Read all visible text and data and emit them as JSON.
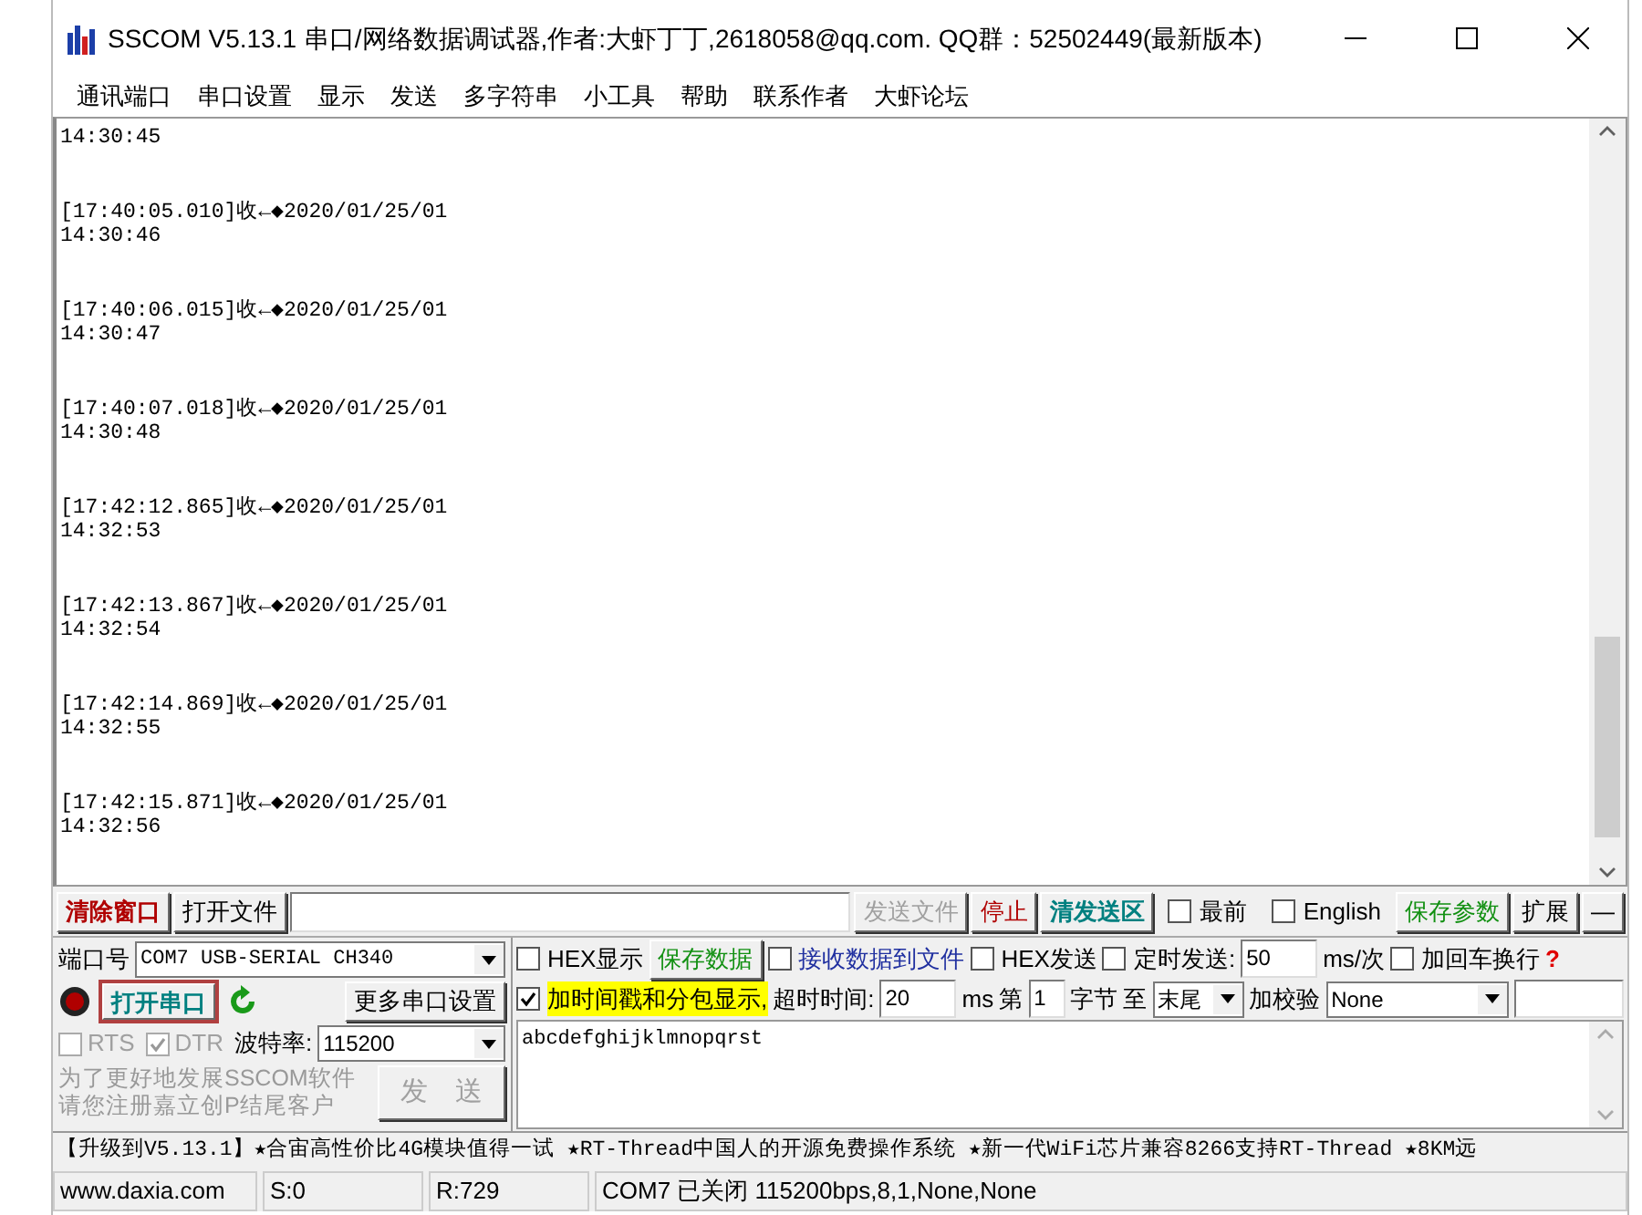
{
  "window": {
    "title": "SSCOM V5.13.1 串口/网络数据调试器,作者:大虾丁丁,2618058@qq.com. QQ群：52502449(最新版本)"
  },
  "menu": [
    "通讯端口",
    "串口设置",
    "显示",
    "发送",
    "多字符串",
    "小工具",
    "帮助",
    "联系作者",
    "大虾论坛"
  ],
  "receive_log": {
    "entries": [
      {
        "value": "14:30:45"
      },
      {
        "header": "[17:40:05.010]收←◆2020/01/25/01",
        "value": "14:30:46"
      },
      {
        "header": "[17:40:06.015]收←◆2020/01/25/01",
        "value": "14:30:47"
      },
      {
        "header": "[17:40:07.018]收←◆2020/01/25/01",
        "value": "14:30:48"
      },
      {
        "header": "[17:42:12.865]收←◆2020/01/25/01",
        "value": "14:32:53"
      },
      {
        "header": "[17:42:13.867]收←◆2020/01/25/01",
        "value": "14:32:54"
      },
      {
        "header": "[17:42:14.869]收←◆2020/01/25/01",
        "value": "14:32:55"
      },
      {
        "header": "[17:42:15.871]收←◆2020/01/25/01",
        "value": "14:32:56"
      }
    ]
  },
  "toolbar": [
    {
      "kind": "button",
      "label": "清除窗口",
      "color": "#b00000",
      "bold": true,
      "disabled": false
    },
    {
      "kind": "button",
      "label": "打开文件",
      "disabled": false
    },
    {
      "kind": "field"
    },
    {
      "kind": "button",
      "label": "发送文件",
      "disabled": true
    },
    {
      "kind": "button",
      "label": "停止",
      "color": "#b00000",
      "disabled": false
    },
    {
      "kind": "button",
      "label": "清发送区",
      "color": "#008080",
      "bold": true,
      "disabled": false
    },
    {
      "kind": "checkbox",
      "label": "最前",
      "checked": false
    },
    {
      "kind": "checkbox",
      "label": "English",
      "checked": false
    },
    {
      "kind": "button",
      "label": "保存参数",
      "color": "#129012",
      "disabled": false
    },
    {
      "kind": "button",
      "label": "扩展",
      "disabled": false
    },
    {
      "kind": "button",
      "label": "—",
      "disabled": false
    }
  ],
  "port_panel": {
    "port_label": "端口号",
    "port": "COM7 USB-SERIAL CH340",
    "open": false,
    "open_button": "打开串口",
    "more_settings": "更多串口设置",
    "rts": {
      "label": "RTS",
      "checked": false,
      "disabled": true
    },
    "dtr": {
      "label": "DTR",
      "checked": true,
      "disabled": true
    },
    "baud_label": "波特率:",
    "baud": "115200",
    "promo": [
      "为了更好地发展SSCOM软件",
      "请您注册嘉立创P结尾客户"
    ],
    "send_button": {
      "label": "发　送",
      "disabled": true
    }
  },
  "options_row_1": [
    {
      "kind": "checkbox",
      "label": "HEX显示",
      "checked": false
    },
    {
      "kind": "button",
      "label": "保存数据",
      "color": "#129012",
      "disabled": false
    },
    {
      "kind": "checkbox",
      "label": "接收数据到文件",
      "checked": false,
      "color": "#2030a0"
    },
    {
      "kind": "checkbox",
      "label": "HEX发送",
      "checked": false
    },
    {
      "kind": "checkbox",
      "label": "定时发送:",
      "checked": false
    },
    {
      "kind": "field",
      "value": "50"
    },
    {
      "kind": "text",
      "text": "ms/次"
    },
    {
      "kind": "checkbox",
      "label": "加回车换行",
      "checked": false
    },
    {
      "kind": "help",
      "text": "?"
    }
  ],
  "options_row_2": [
    {
      "kind": "checkbox",
      "label": "加时间戳和分包显示,",
      "checked": true,
      "highlighted": true
    },
    {
      "kind": "text",
      "text": "超时时间:"
    },
    {
      "kind": "field",
      "value": "20"
    },
    {
      "kind": "text",
      "text": "ms"
    },
    {
      "kind": "text",
      "text": "第"
    },
    {
      "kind": "field",
      "value": "1"
    },
    {
      "kind": "text",
      "text": "字节"
    },
    {
      "kind": "text",
      "text": "至"
    },
    {
      "kind": "select",
      "value": "末尾"
    },
    {
      "kind": "text",
      "text": "加校验"
    },
    {
      "kind": "select",
      "value": "None"
    },
    {
      "kind": "field"
    }
  ],
  "send_area": {
    "value": "abcdefghijklmnopqrst"
  },
  "ticker": "【升级到V5.13.1】★合宙高性价比4G模块值得一试 ★RT-Thread中国人的开源免费操作系统 ★新一代WiFi芯片兼容8266支持RT-Thread ★8KM远",
  "status_bar": [
    "www.daxia.com",
    "S:0",
    "R:729",
    "COM7 已关闭  115200bps,8,1,None,None"
  ]
}
